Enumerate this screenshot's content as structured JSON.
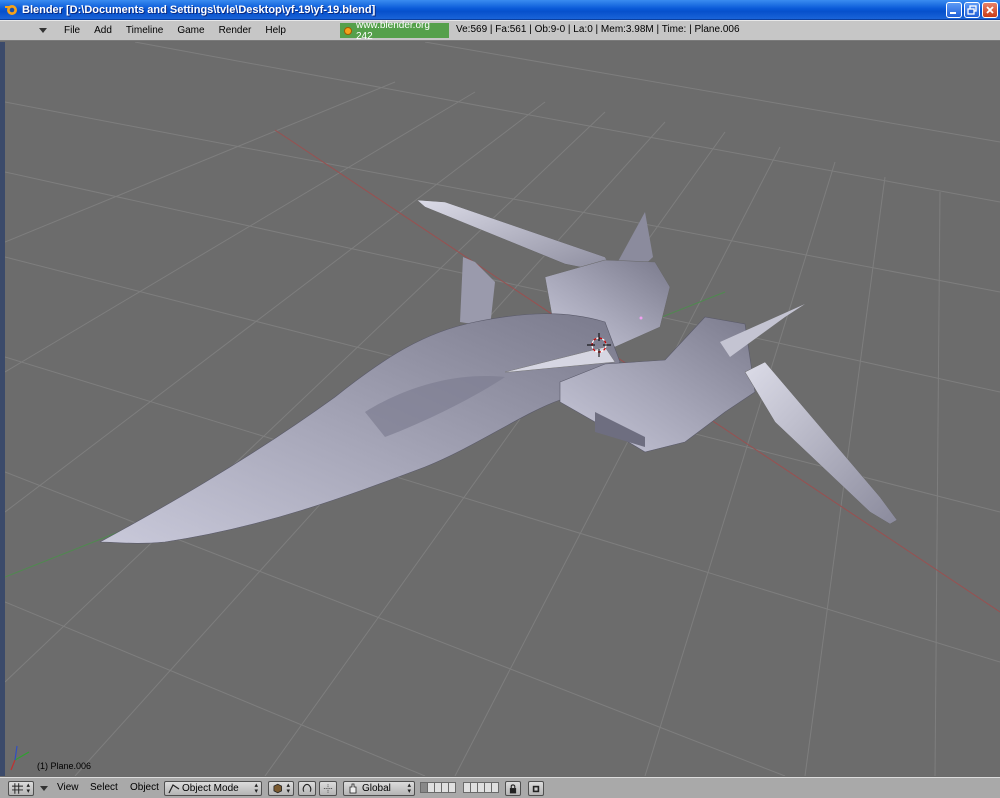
{
  "window": {
    "title": "Blender [D:\\Documents and Settings\\tvle\\Desktop\\yf-19\\yf-19.blend]"
  },
  "info_header": {
    "menus": [
      "File",
      "Add",
      "Timeline",
      "Game",
      "Render",
      "Help"
    ],
    "link_text": "www.blender.org 242",
    "stats": "Ve:569 | Fa:561 | Ob:9-0 | La:0  | Mem:3.98M  | Time: | Plane.006"
  },
  "viewport": {
    "object_label": "(1) Plane.006"
  },
  "view_header": {
    "menus": [
      "View",
      "Select",
      "Object"
    ],
    "mode": "Object Mode",
    "orientation": "Global"
  },
  "colors": {
    "viewport_bg": "#6c6c6c",
    "header_bg": "#c6c6c6",
    "link_bg": "#55a04b"
  }
}
